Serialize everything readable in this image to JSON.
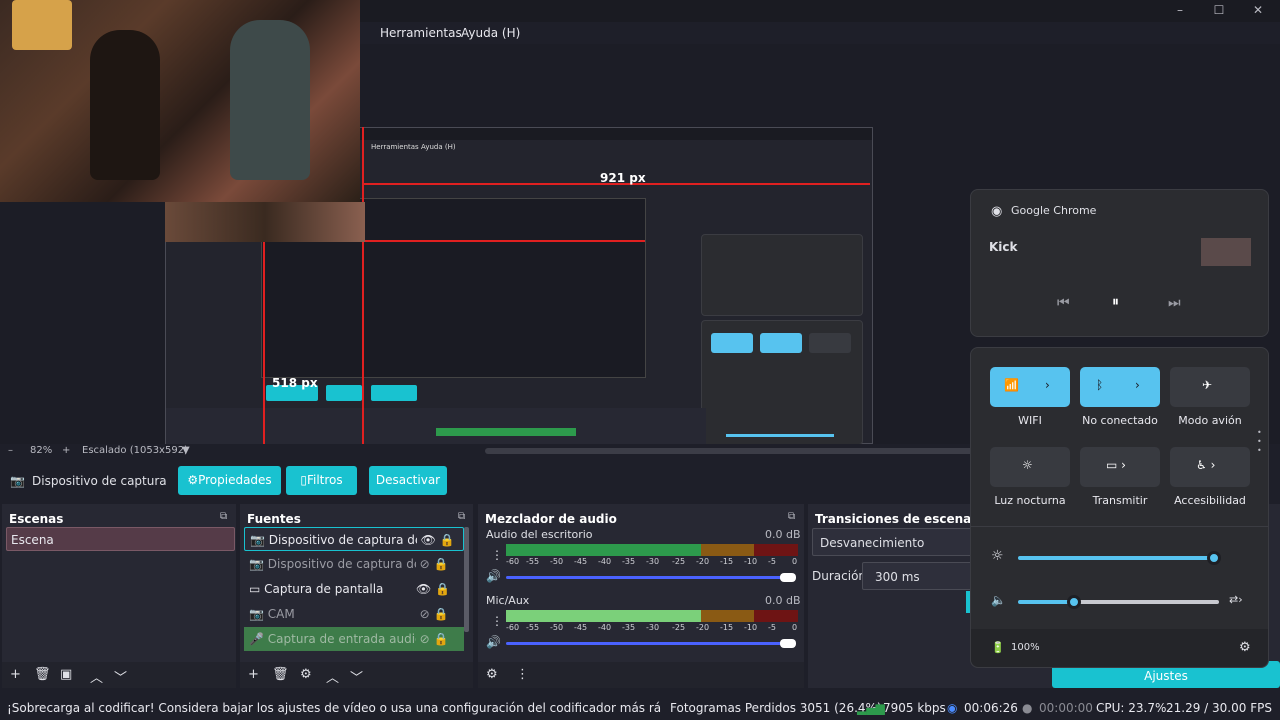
{
  "menubar": {
    "items": [
      "Herramientas",
      "Ayuda (H)"
    ]
  },
  "window_controls": [
    "–",
    "☐",
    "✕"
  ],
  "preview": {
    "nested_label_921": "921 px",
    "nested_label_518": "518 px",
    "nested_menu": [
      "Herramientas",
      "Ayuda (H)"
    ]
  },
  "zoom": {
    "minus": "–",
    "value": "82%",
    "plus": "+",
    "scale": "Escalado (1053x592)"
  },
  "source_toolbar": {
    "source_name": "Dispositivo de captura de v",
    "properties_label": "Propiedades",
    "filters_label": "Filtros",
    "deactivate_label": "Desactivar"
  },
  "scenes": {
    "title": "Escenas",
    "items": [
      "Escena"
    ]
  },
  "sources": {
    "title": "Fuentes",
    "items": [
      {
        "label": "Dispositivo de captura de vide",
        "icon": "camera-icon",
        "visible": true
      },
      {
        "label": "Dispositivo de captura de vide",
        "icon": "camera-icon",
        "visible": false
      },
      {
        "label": "Captura de pantalla",
        "icon": "monitor-icon",
        "visible": true
      },
      {
        "label": "CAM",
        "icon": "camera-icon",
        "visible": false
      },
      {
        "label": "Captura de entrada audio",
        "icon": "mic-icon",
        "visible": false
      }
    ]
  },
  "mixer": {
    "title": "Mezclador de audio",
    "channels": [
      {
        "name": "Audio del escritorio",
        "db": "0.0 dB",
        "level": 0.6
      },
      {
        "name": "Mic/Aux",
        "db": "0.0 dB",
        "level": 0.7
      }
    ],
    "ticks": [
      "-60",
      "-55",
      "-50",
      "-45",
      "-40",
      "-35",
      "-30",
      "-25",
      "-20",
      "-15",
      "-10",
      "-5",
      "0"
    ]
  },
  "transitions": {
    "title": "Transiciones de escena",
    "type": "Desvanecimiento",
    "duration_label": "Duración",
    "duration_value": "300 ms",
    "settings_label": "Ajustes"
  },
  "quick_settings": {
    "media_app": "Google Chrome",
    "media_title": "Kick",
    "wifi_label": "WIFI",
    "bluetooth_label": "No conectado",
    "airplane_label": "Modo avión",
    "night_label": "Luz nocturna",
    "cast_label": "Transmitir",
    "accessibility_label": "Accesibilidad",
    "brightness": 0.9,
    "volume": 0.22,
    "battery": "100%"
  },
  "statusbar": {
    "warning": "¡Sobrecarga al codificar! Considera bajar los ajustes de vídeo o usa una configuración del codificador más rápida.",
    "dropped": "Fotogramas Perdidos 3051 (26.4%)",
    "bitrate": "7905 kbps",
    "stream_time": "00:06:26",
    "rec_time": "00:00:00",
    "cpu": "CPU: 23.7%",
    "fps": "21.29 / 30.00 FPS"
  }
}
